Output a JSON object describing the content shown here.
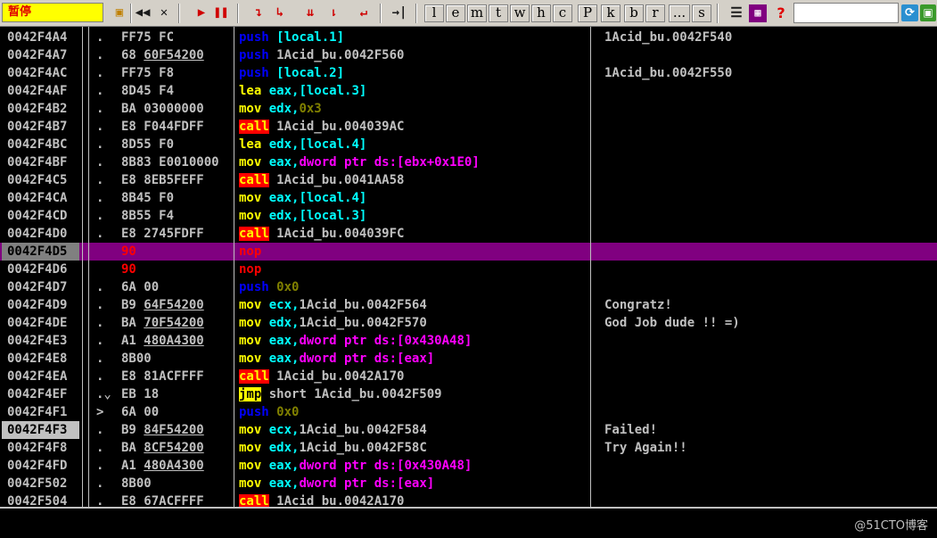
{
  "toolbar": {
    "status": "暂停",
    "nav_buttons": [
      "◀◀",
      "✕"
    ],
    "run_buttons": [
      "▶",
      "❚❚"
    ],
    "step_buttons": [
      "↴",
      "↳",
      "⇊",
      "⇂",
      "↵",
      "→|"
    ],
    "letters": [
      "l",
      "e",
      "m",
      "t",
      "w",
      "h",
      "c",
      "P",
      "k",
      "b",
      "r",
      "...",
      "s"
    ],
    "help": "?",
    "refresh": "⟳",
    "window": "▣"
  },
  "rows": [
    {
      "addr": "0042F4A4",
      "mark": ".",
      "hex": "FF75 FC",
      "op": "push",
      "opclass": "op-blue",
      "args": [
        {
          "t": "[local.1]",
          "c": "arg-cyan"
        }
      ],
      "comment": "1Acid_bu.0042F540"
    },
    {
      "addr": "0042F4A7",
      "mark": ".",
      "hex": "68 60F54200",
      "hexu": "60F54200",
      "hexpre": "68 ",
      "op": "push",
      "opclass": "op-blue",
      "args": [
        {
          "t": "1Acid_bu.0042F560",
          "c": "arg-white"
        }
      ],
      "comment": ""
    },
    {
      "addr": "0042F4AC",
      "mark": ".",
      "hex": "FF75 F8",
      "op": "push",
      "opclass": "op-blue",
      "args": [
        {
          "t": "[local.2]",
          "c": "arg-cyan"
        }
      ],
      "comment": "1Acid_bu.0042F550"
    },
    {
      "addr": "0042F4AF",
      "mark": ".",
      "hex": "8D45 F4",
      "op": "lea",
      "opclass": "op-yellow",
      "args": [
        {
          "t": "eax,",
          "c": "arg-cyan"
        },
        {
          "t": "[local.3]",
          "c": "arg-cyan"
        }
      ],
      "comment": ""
    },
    {
      "addr": "0042F4B2",
      "mark": ".",
      "hex": "BA 03000000",
      "op": "mov",
      "opclass": "op-yellow",
      "args": [
        {
          "t": "edx,",
          "c": "arg-cyan"
        },
        {
          "t": "0x3",
          "c": "arg-olive"
        }
      ],
      "comment": ""
    },
    {
      "addr": "0042F4B7",
      "mark": ".",
      "hex": "E8 F044FDFF",
      "op": "call",
      "opclass": "op-call",
      "args": [
        {
          "t": "1Acid_bu.004039AC",
          "c": "arg-white"
        }
      ],
      "comment": ""
    },
    {
      "addr": "0042F4BC",
      "mark": ".",
      "hex": "8D55 F0",
      "op": "lea",
      "opclass": "op-yellow",
      "args": [
        {
          "t": "edx,",
          "c": "arg-cyan"
        },
        {
          "t": "[local.4]",
          "c": "arg-cyan"
        }
      ],
      "comment": ""
    },
    {
      "addr": "0042F4BF",
      "mark": ".",
      "hex": "8B83 E0010000",
      "op": "mov",
      "opclass": "op-yellow",
      "args": [
        {
          "t": "eax,",
          "c": "arg-cyan"
        },
        {
          "t": "dword ptr ds:[ebx+0x1E0]",
          "c": "arg-mag"
        }
      ],
      "comment": ""
    },
    {
      "addr": "0042F4C5",
      "mark": ".",
      "hex": "E8 8EB5FEFF",
      "op": "call",
      "opclass": "op-call",
      "args": [
        {
          "t": "1Acid_bu.0041AA58",
          "c": "arg-white"
        }
      ],
      "comment": ""
    },
    {
      "addr": "0042F4CA",
      "mark": ".",
      "hex": "8B45 F0",
      "op": "mov",
      "opclass": "op-yellow",
      "args": [
        {
          "t": "eax,",
          "c": "arg-cyan"
        },
        {
          "t": "[local.4]",
          "c": "arg-cyan"
        }
      ],
      "comment": ""
    },
    {
      "addr": "0042F4CD",
      "mark": ".",
      "hex": "8B55 F4",
      "op": "mov",
      "opclass": "op-yellow",
      "args": [
        {
          "t": "edx,",
          "c": "arg-cyan"
        },
        {
          "t": "[local.3]",
          "c": "arg-cyan"
        }
      ],
      "comment": ""
    },
    {
      "addr": "0042F4D0",
      "mark": ".",
      "hex": "E8 2745FDFF",
      "op": "call",
      "opclass": "op-call",
      "args": [
        {
          "t": "1Acid_bu.004039FC",
          "c": "arg-white"
        }
      ],
      "comment": ""
    },
    {
      "addr": "0042F4D5",
      "mark": "",
      "hex": "90",
      "hexred": true,
      "op": "nop",
      "opclass": "op-nop",
      "args": [],
      "comment": "",
      "highlight": true
    },
    {
      "addr": "0042F4D6",
      "mark": "",
      "hex": "90",
      "hexred": true,
      "op": "nop",
      "opclass": "op-nop",
      "args": [],
      "comment": ""
    },
    {
      "addr": "0042F4D7",
      "mark": ".",
      "hex": "6A 00",
      "op": "push",
      "opclass": "op-blue",
      "args": [
        {
          "t": "0x0",
          "c": "arg-olive"
        }
      ],
      "comment": ""
    },
    {
      "addr": "0042F4D9",
      "mark": ".",
      "hex": "B9 64F54200",
      "hexu": "64F54200",
      "hexpre": "B9 ",
      "op": "mov",
      "opclass": "op-yellow",
      "args": [
        {
          "t": "ecx,",
          "c": "arg-cyan"
        },
        {
          "t": "1Acid_bu.0042F564",
          "c": "arg-white"
        }
      ],
      "comment": "Congratz!"
    },
    {
      "addr": "0042F4DE",
      "mark": ".",
      "hex": "BA 70F54200",
      "hexu": "70F54200",
      "hexpre": "BA ",
      "op": "mov",
      "opclass": "op-yellow",
      "args": [
        {
          "t": "edx,",
          "c": "arg-cyan"
        },
        {
          "t": "1Acid_bu.0042F570",
          "c": "arg-white"
        }
      ],
      "comment": "God Job dude !! =)"
    },
    {
      "addr": "0042F4E3",
      "mark": ".",
      "hex": "A1 480A4300",
      "hexu": "480A4300",
      "hexpre": "A1 ",
      "op": "mov",
      "opclass": "op-yellow",
      "args": [
        {
          "t": "eax,",
          "c": "arg-cyan"
        },
        {
          "t": "dword ptr ds:[0x430A48]",
          "c": "arg-mag"
        }
      ],
      "comment": ""
    },
    {
      "addr": "0042F4E8",
      "mark": ".",
      "hex": "8B00",
      "op": "mov",
      "opclass": "op-yellow",
      "args": [
        {
          "t": "eax,",
          "c": "arg-cyan"
        },
        {
          "t": "dword ptr ds:[eax]",
          "c": "arg-mag"
        }
      ],
      "comment": ""
    },
    {
      "addr": "0042F4EA",
      "mark": ".",
      "hex": "E8 81ACFFFF",
      "op": "call",
      "opclass": "op-call",
      "args": [
        {
          "t": "1Acid_bu.0042A170",
          "c": "arg-white"
        }
      ],
      "comment": ""
    },
    {
      "addr": "0042F4EF",
      "mark": ".⌄",
      "hex": "EB 18",
      "op": "jmp",
      "opclass": "op-jmp",
      "args": [
        {
          "t": "short 1Acid_bu.0042F509",
          "c": "arg-white"
        }
      ],
      "comment": ""
    },
    {
      "addr": "0042F4F1",
      "mark": ">",
      "hex": "6A 00",
      "op": "push",
      "opclass": "op-blue",
      "args": [
        {
          "t": "0x0",
          "c": "arg-olive"
        }
      ],
      "comment": ""
    },
    {
      "addr": "0042F4F3",
      "mark": ".",
      "hex": "B9 84F54200",
      "hexu": "84F54200",
      "hexpre": "B9 ",
      "op": "mov",
      "opclass": "op-yellow",
      "args": [
        {
          "t": "ecx,",
          "c": "arg-cyan"
        },
        {
          "t": "1Acid_bu.0042F584",
          "c": "arg-white"
        }
      ],
      "comment": "Failed!",
      "addrhl": true
    },
    {
      "addr": "0042F4F8",
      "mark": ".",
      "hex": "BA 8CF54200",
      "hexu": "8CF54200",
      "hexpre": "BA ",
      "op": "mov",
      "opclass": "op-yellow",
      "args": [
        {
          "t": "edx,",
          "c": "arg-cyan"
        },
        {
          "t": "1Acid_bu.0042F58C",
          "c": "arg-white"
        }
      ],
      "comment": "Try Again!!"
    },
    {
      "addr": "0042F4FD",
      "mark": ".",
      "hex": "A1 480A4300",
      "hexu": "480A4300",
      "hexpre": "A1 ",
      "op": "mov",
      "opclass": "op-yellow",
      "args": [
        {
          "t": "eax,",
          "c": "arg-cyan"
        },
        {
          "t": "dword ptr ds:[0x430A48]",
          "c": "arg-mag"
        }
      ],
      "comment": ""
    },
    {
      "addr": "0042F502",
      "mark": ".",
      "hex": "8B00",
      "op": "mov",
      "opclass": "op-yellow",
      "args": [
        {
          "t": "eax,",
          "c": "arg-cyan"
        },
        {
          "t": "dword ptr ds:[eax]",
          "c": "arg-mag"
        }
      ],
      "comment": ""
    },
    {
      "addr": "0042F504",
      "mark": ".",
      "hex": "E8 67ACFFFF",
      "op": "call",
      "opclass": "op-call",
      "args": [
        {
          "t": "1Acid_bu.0042A170",
          "c": "arg-white"
        }
      ],
      "comment": ""
    }
  ],
  "watermark": "@51CTO博客"
}
